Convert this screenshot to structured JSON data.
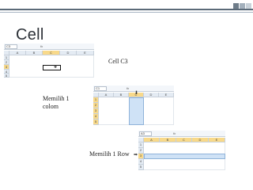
{
  "slide": {
    "title": "Cell"
  },
  "captions": {
    "cell": "Cell C3",
    "column": "Memilih 1 colom",
    "row": "Memilih 1 Row"
  },
  "colors": {
    "header_square_1": "#6f7d8a",
    "header_square_2": "#a3b0bc",
    "header_square_3": "#c9d2da",
    "selected_header": "#f8d98a",
    "selection_fill": "#cfe2f6"
  },
  "sheet1": {
    "name_box": "C3",
    "fx": "fx",
    "columns": [
      "A",
      "B",
      "C",
      "D",
      "E"
    ],
    "rows": [
      "1",
      "2",
      "3",
      "4",
      "5"
    ],
    "active_cell": "C3",
    "cursor_icon": "cross-cursor"
  },
  "sheet2": {
    "name_box": "C1",
    "fx": "fx",
    "columns": [
      "A",
      "B",
      "C",
      "D",
      "E"
    ],
    "rows": [
      "1",
      "2",
      "3",
      "4",
      "5"
    ],
    "selected_column": "C",
    "cursor_icon": "down-arrow-cursor"
  },
  "sheet3": {
    "name_box": "A3",
    "fx": "fx",
    "columns": [
      "A",
      "B",
      "C",
      "D",
      "E"
    ],
    "rows": [
      "1",
      "2",
      "3",
      "4",
      "5"
    ],
    "selected_row": "3",
    "cursor_icon": "right-arrow-cursor"
  }
}
